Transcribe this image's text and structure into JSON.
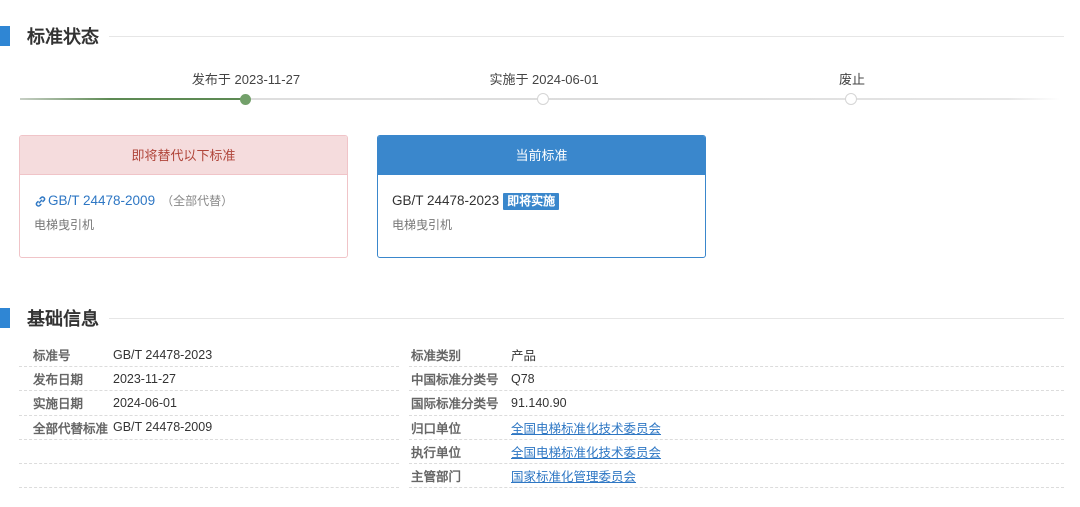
{
  "status_section": {
    "title": "标准状态"
  },
  "timeline": {
    "steps": [
      {
        "label": "发布于 2023-11-27",
        "active": true
      },
      {
        "label": "实施于 2024-06-01",
        "active": false
      },
      {
        "label": "废止",
        "active": false
      }
    ]
  },
  "replace_card": {
    "header": "即将替代以下标准",
    "code": "GB/T 24478-2009",
    "note": "（全部代替）",
    "name": "电梯曳引机",
    "icon": "link-icon"
  },
  "current_card": {
    "header": "当前标准",
    "code": "GB/T 24478-2023",
    "badge": "即将实施",
    "name": "电梯曳引机"
  },
  "basic_section": {
    "title": "基础信息"
  },
  "basic_info": {
    "left": [
      {
        "key": "标准号",
        "value": "GB/T 24478-2023"
      },
      {
        "key": "发布日期",
        "value": "2023-11-27"
      },
      {
        "key": "实施日期",
        "value": "2024-06-01"
      },
      {
        "key": "全部代替标准",
        "value": "GB/T 24478-2009"
      },
      {
        "key": "",
        "value": ""
      },
      {
        "key": "",
        "value": ""
      }
    ],
    "right": [
      {
        "key": "标准类别",
        "value": "产品"
      },
      {
        "key": "中国标准分类号",
        "value": "Q78"
      },
      {
        "key": "国际标准分类号",
        "value": "91.140.90"
      },
      {
        "key": "归口单位",
        "value": "全国电梯标准化技术委员会"
      },
      {
        "key": "执行单位",
        "value": "全国电梯标准化技术委员会"
      },
      {
        "key": "主管部门",
        "value": "国家标准化管理委员会"
      }
    ]
  },
  "colors": {
    "accent": "#2f86d4",
    "card_replace_bg": "#f5dcdd",
    "card_replace_text": "#b0453a",
    "card_current_bg": "#3a87cc",
    "timeline_done": "#5d8a53",
    "link": "#2e77c4"
  }
}
